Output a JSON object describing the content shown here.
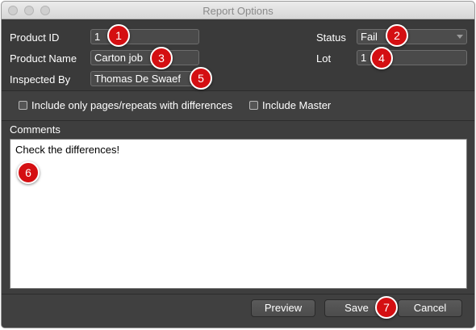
{
  "window": {
    "title": "Report Options"
  },
  "form": {
    "product_id": {
      "label": "Product ID",
      "value": "1"
    },
    "status": {
      "label": "Status",
      "value": "Fail"
    },
    "product_name": {
      "label": "Product Name",
      "value": "Carton job"
    },
    "lot": {
      "label": "Lot",
      "value": "1"
    },
    "inspected_by": {
      "label": "Inspected By",
      "value": "Thomas De Swaef"
    }
  },
  "options": {
    "differences_only": {
      "label": "Include only pages/repeats with differences",
      "checked": false
    },
    "include_master": {
      "label": "Include Master",
      "checked": false
    }
  },
  "comments": {
    "label": "Comments",
    "value": "Check the differences!"
  },
  "buttons": {
    "preview": "Preview",
    "save": "Save",
    "cancel": "Cancel"
  },
  "badges": [
    "1",
    "2",
    "3",
    "4",
    "5",
    "6",
    "7"
  ],
  "colors": {
    "badge": "#d40f12",
    "panel": "#3e3e3e"
  }
}
